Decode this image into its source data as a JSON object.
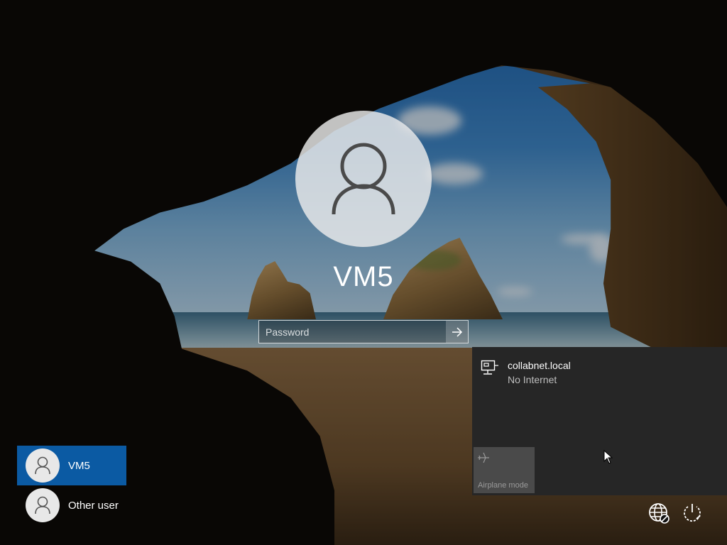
{
  "login": {
    "username": "VM5",
    "password_placeholder": "Password"
  },
  "users": [
    {
      "label": "VM5",
      "selected": true
    },
    {
      "label": "Other user",
      "selected": false
    }
  ],
  "network_flyout": {
    "network_name": "collabnet.local",
    "network_status": "No Internet",
    "airplane_mode_label": "Airplane mode"
  },
  "icons": {
    "avatar": "user-silhouette-icon",
    "submit": "arrow-right-icon",
    "network": "ethernet-icon",
    "airplane": "airplane-icon",
    "network_status": "globe-no-connection-icon",
    "power": "power-icon"
  },
  "colors": {
    "selected_user": "#0b5aa3",
    "flyout_bg": "#262626"
  }
}
